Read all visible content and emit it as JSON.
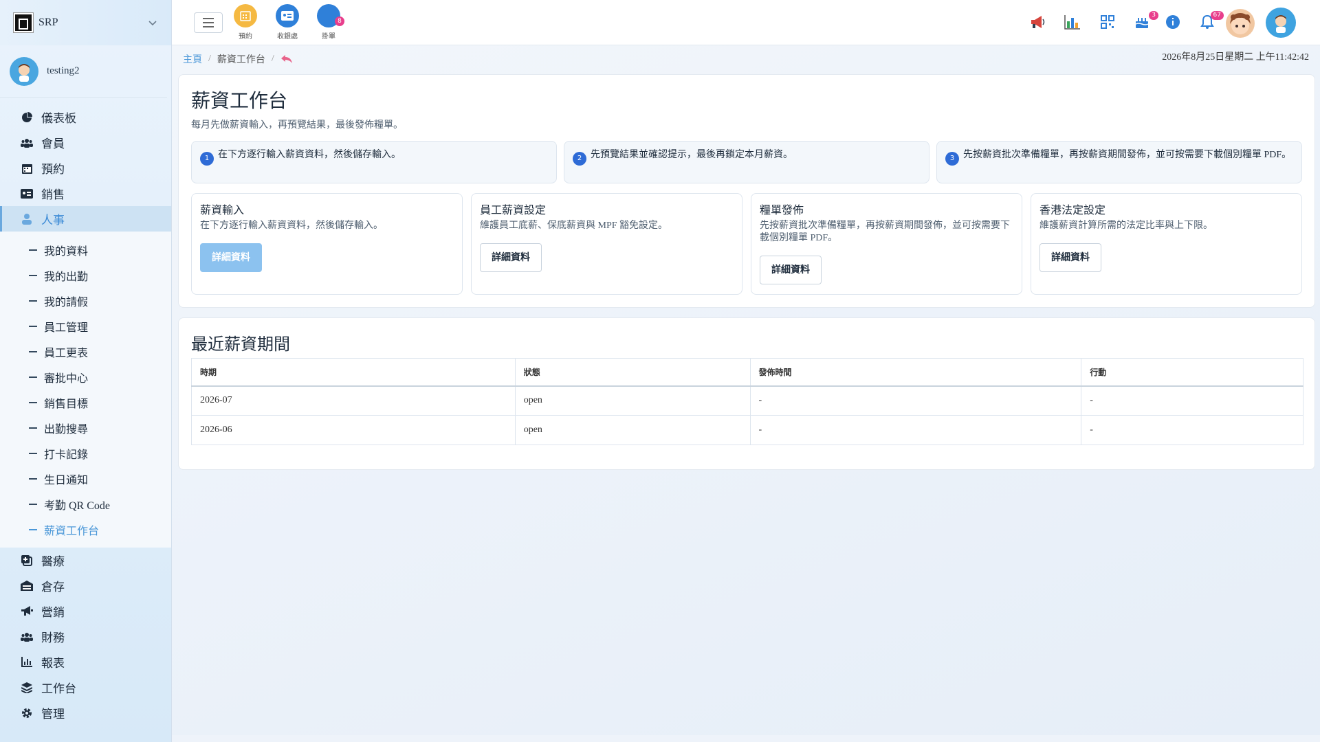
{
  "brand": {
    "name": "SRP"
  },
  "user": {
    "name": "testing2"
  },
  "nav": {
    "items": [
      {
        "label": "儀表板"
      },
      {
        "label": "會員"
      },
      {
        "label": "預約"
      },
      {
        "label": "銷售"
      },
      {
        "label": "人事"
      }
    ],
    "sub_items": [
      {
        "label": "我的資料"
      },
      {
        "label": "我的出勤"
      },
      {
        "label": "我的請假"
      },
      {
        "label": "員工管理"
      },
      {
        "label": "員工更表"
      },
      {
        "label": "審批中心"
      },
      {
        "label": "銷售目標"
      },
      {
        "label": "出勤搜尋"
      },
      {
        "label": "打卡記錄"
      },
      {
        "label": "生日通知"
      },
      {
        "label": "考勤 QR Code"
      },
      {
        "label": "薪資工作台"
      }
    ],
    "items_after": [
      {
        "label": "醫療"
      },
      {
        "label": "倉存"
      },
      {
        "label": "營銷"
      },
      {
        "label": "財務"
      },
      {
        "label": "報表"
      },
      {
        "label": "工作台"
      },
      {
        "label": "管理"
      }
    ]
  },
  "topbar": {
    "quick": [
      {
        "label": "預約",
        "color": "#f5b942"
      },
      {
        "label": "收銀處",
        "color": "#2f80d9"
      },
      {
        "label": "掛單",
        "color": "#2f80d9",
        "badge": "8"
      }
    ],
    "badges": {
      "cake": "3",
      "bell": "67"
    }
  },
  "breadcrumb": {
    "home": "主頁",
    "current": "薪資工作台"
  },
  "datetime": "2026年8月25日星期二 上午11:42:42",
  "page": {
    "title": "薪資工作台",
    "subtitle": "每月先做薪資輸入，再預覽結果，最後發佈糧單。",
    "steps": [
      {
        "num": "1",
        "text": "在下方逐行輸入薪資資料，然後儲存輸入。"
      },
      {
        "num": "2",
        "text": "先預覽結果並確認提示，最後再鎖定本月薪資。"
      },
      {
        "num": "3",
        "text": "先按薪資批次準備糧單，再按薪資期間發佈，並可按需要下載個別糧單 PDF。"
      }
    ],
    "modules": [
      {
        "title": "薪資輸入",
        "desc": "在下方逐行輸入薪資資料，然後儲存輸入。",
        "button": "詳細資料"
      },
      {
        "title": "員工薪資設定",
        "desc": "維護員工底薪、保底薪資與 MPF 豁免設定。",
        "button": "詳細資料"
      },
      {
        "title": "糧單發佈",
        "desc": "先按薪資批次準備糧單，再按薪資期間發佈，並可按需要下載個別糧單 PDF。",
        "button": "詳細資料"
      },
      {
        "title": "香港法定設定",
        "desc": "維護薪資計算所需的法定比率與上下限。",
        "button": "詳細資料"
      }
    ]
  },
  "recent": {
    "title": "最近薪資期間",
    "columns": [
      "時期",
      "狀態",
      "發佈時間",
      "行動"
    ],
    "rows": [
      [
        "2026-07",
        "open",
        "-",
        "-"
      ],
      [
        "2026-06",
        "open",
        "-",
        "-"
      ]
    ]
  }
}
